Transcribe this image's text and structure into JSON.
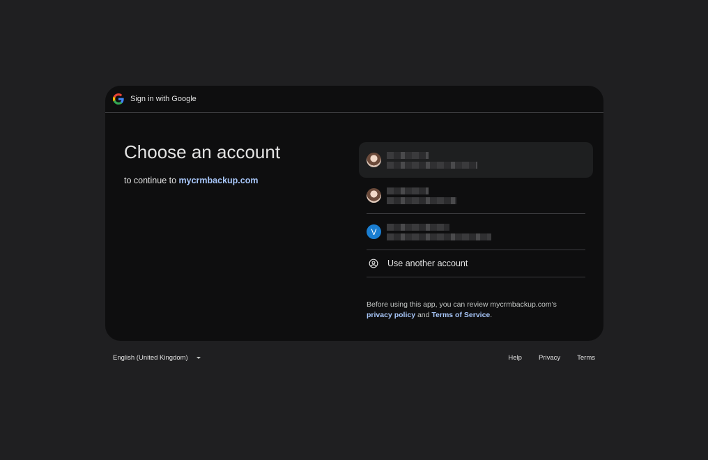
{
  "header": {
    "title": "Sign in with Google",
    "logo_icon": "google-g-icon"
  },
  "main": {
    "heading": "Choose an account",
    "subtitle_prefix": "to continue to ",
    "subtitle_link": "mycrmbackup.com"
  },
  "accounts": {
    "items": [
      {
        "avatar": "photo"
      },
      {
        "avatar": "photo"
      },
      {
        "avatar": "letter",
        "letter": "V",
        "color": "#1a7ed1"
      }
    ],
    "use_another_label": "Use another account",
    "use_another_icon": "person-circle-icon"
  },
  "disclaimer": {
    "prefix": "Before using this app, you can review mycrmbackup.com’s",
    "privacy_link": "privacy policy",
    "and": " and ",
    "terms_link": "Terms of Service",
    "suffix": "."
  },
  "footer": {
    "language": "English (United Kingdom)",
    "links": [
      "Help",
      "Privacy",
      "Terms"
    ]
  },
  "colors": {
    "background": "#1f1f21",
    "card": "#0e0e0f",
    "link": "#a8c7fa"
  }
}
